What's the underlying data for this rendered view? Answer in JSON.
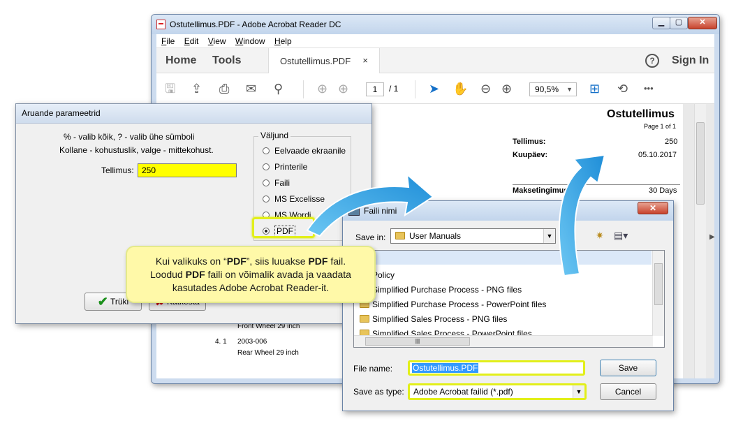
{
  "acrobat": {
    "title": "Ostutellimus.PDF - Adobe Acrobat Reader DC",
    "menu": [
      "File",
      "Edit",
      "View",
      "Window",
      "Help"
    ],
    "tabs": {
      "home": "Home",
      "tools": "Tools",
      "doc": "Ostutellimus.PDF",
      "close": "×"
    },
    "help": "?",
    "sign_in": "Sign In",
    "page_current": "1",
    "page_total": "/ 1",
    "zoom": "90,5%",
    "more": "•••",
    "document": {
      "title": "Ostutellimus",
      "page_of": "Page 1 of 1",
      "order_label": "Tellimus:",
      "order_value": "250",
      "date_label": "Kuupäev:",
      "date_value": "05.10.2017",
      "payment_label": "Maksetingimus",
      "payment_value": "30 Days",
      "line_desc_1": "Front Wheel 29 inch",
      "line_no_2": "4. 1",
      "line_code_2": "2003-006",
      "line_desc_2": "Rear Wheel 29 inch"
    }
  },
  "params_dialog": {
    "title": "Aruande parameetrid",
    "hint_line1": "% - valib kõik, ? - valib ühe sümboli",
    "hint_line2": "Kollane - kohustuslik, valge - mittekohust.",
    "order_label": "Tellimus:",
    "order_value": "250",
    "output_legend": "Väljund",
    "output_options": [
      "Eelvaade ekraanile",
      "Printerile",
      "Faili",
      "MS Excelisse",
      "MS Wordi",
      "PDF"
    ],
    "selected_output": "PDF",
    "print_button": "Trüki",
    "cancel_button": "Katkesta"
  },
  "save_dialog": {
    "title": "Faili nimi",
    "save_in_label": "Save in:",
    "save_in_value": "User Manuals",
    "items": [
      "Policy",
      "Simplified Purchase Process - PNG files",
      "Simplified Purchase Process - PowerPoint files",
      "Simplified Sales Process - PNG files",
      "Simplified Sales Process - PowerPoint files"
    ],
    "file_name_label": "File name:",
    "file_name_value": "Ostutellimus.PDF",
    "save_type_label": "Save as type:",
    "save_type_value": "Adobe Acrobat failid (*.pdf)",
    "save_button": "Save",
    "cancel_button": "Cancel"
  },
  "callout": {
    "line1_a": "Kui valikuks on “",
    "line1_b": "PDF",
    "line1_c": "”, siis luuakse ",
    "line1_d": "PDF",
    "line1_e": " fail.",
    "line2_a": "Loodud ",
    "line2_b": "PDF",
    "line2_c": " faili on võimalik avada ja vaadata",
    "line3": "kasutades Adobe Acrobat Reader-it."
  },
  "colors": {
    "required": "#ffff00",
    "highlight": "#e2ef1a",
    "arrow": "#3aa3e3",
    "callout": "#fff9a8"
  }
}
